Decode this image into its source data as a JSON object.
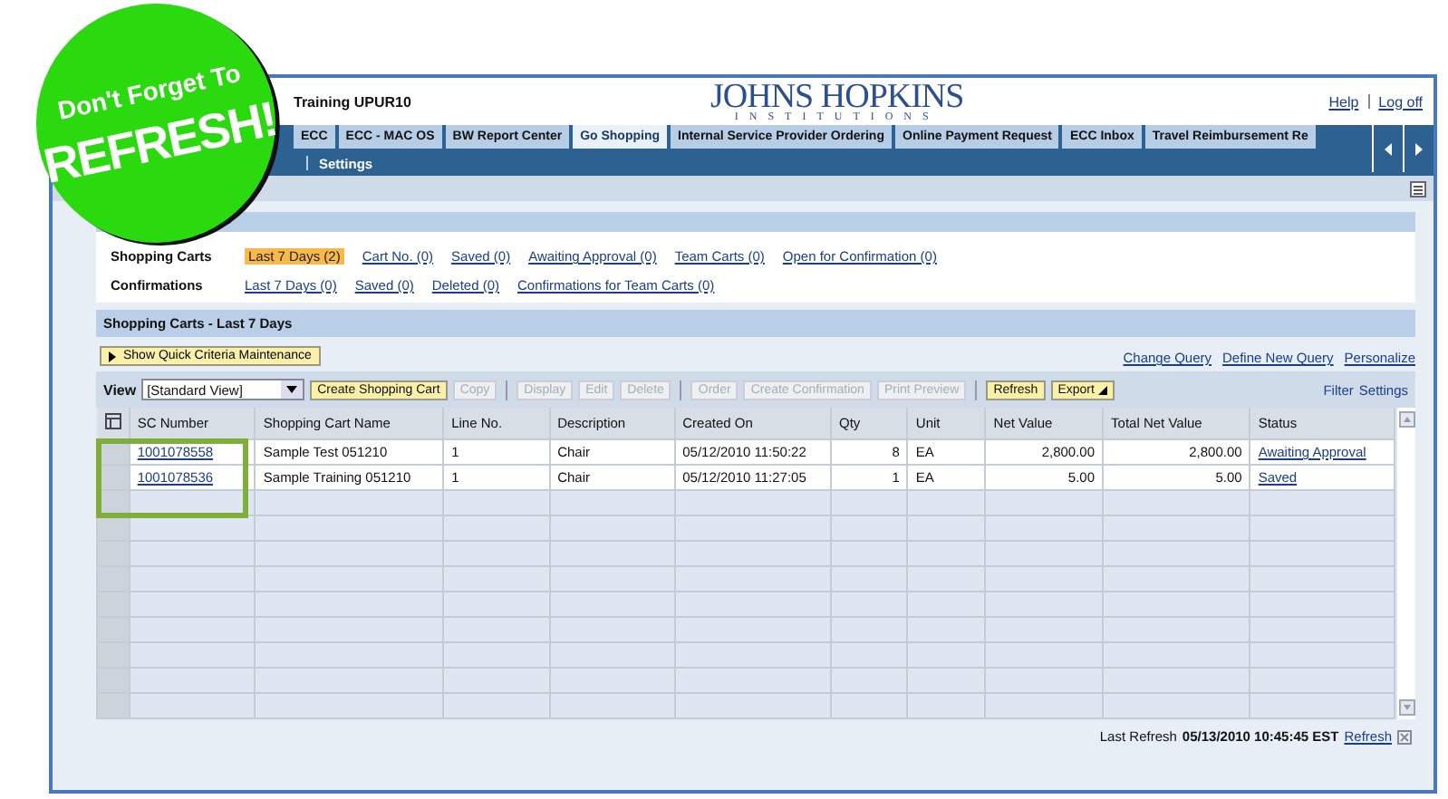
{
  "sticker": {
    "line_1": "Don't Forget To",
    "line_2": "REFRESH!"
  },
  "header": {
    "title": "Training UPUR10",
    "logo": "JOHNS HOPKINS",
    "logo_sub": "INSTITUTIONS",
    "links": [
      "Help",
      "Log off"
    ]
  },
  "tabs": [
    {
      "label": "ECC",
      "selected": false
    },
    {
      "label": "ECC - MAC OS",
      "selected": false
    },
    {
      "label": "BW Report Center",
      "selected": false
    },
    {
      "label": "Go Shopping",
      "selected": true
    },
    {
      "label": "Internal Service Provider Ordering",
      "selected": false
    },
    {
      "label": "Online Payment Request",
      "selected": false
    },
    {
      "label": "ECC Inbox",
      "selected": false
    },
    {
      "label": "Travel Reimbursement Re",
      "selected": false
    }
  ],
  "subnav": [
    "Settings"
  ],
  "queries": [
    {
      "label": "Shopping Carts",
      "links": [
        {
          "label": "Last 7 Days (2)",
          "selected": true
        },
        {
          "label": "Cart No. (0)",
          "selected": false
        },
        {
          "label": "Saved (0)",
          "selected": false
        },
        {
          "label": "Awaiting Approval (0)",
          "selected": false
        },
        {
          "label": "Team Carts (0)",
          "selected": false
        },
        {
          "label": "Open for Confirmation (0)",
          "selected": false
        }
      ]
    },
    {
      "label": "Confirmations",
      "links": [
        {
          "label": "Last 7 Days (0)",
          "selected": false
        },
        {
          "label": "Saved (0)",
          "selected": false
        },
        {
          "label": "Deleted (0)",
          "selected": false
        },
        {
          "label": "Confirmations for Team Carts (0)",
          "selected": false
        }
      ]
    }
  ],
  "panel": {
    "title": "Shopping Carts - Last 7 Days",
    "criteria_button": "Show Quick Criteria Maintenance",
    "query_links": [
      "Change Query",
      "Define New Query",
      "Personalize"
    ],
    "view_label": "View",
    "view_value": "[Standard View]",
    "toolbar": [
      {
        "kind": "button",
        "label": "Create Shopping Cart",
        "disabled": false
      },
      {
        "kind": "button",
        "label": "Copy",
        "disabled": true
      },
      {
        "kind": "separator"
      },
      {
        "kind": "button",
        "label": "Display",
        "disabled": true
      },
      {
        "kind": "button",
        "label": "Edit",
        "disabled": true
      },
      {
        "kind": "button",
        "label": "Delete",
        "disabled": true
      },
      {
        "kind": "separator"
      },
      {
        "kind": "button",
        "label": "Order",
        "disabled": true
      },
      {
        "kind": "button",
        "label": "Create Confirmation",
        "disabled": true
      },
      {
        "kind": "button",
        "label": "Print Preview",
        "disabled": true
      },
      {
        "kind": "separator"
      },
      {
        "kind": "button",
        "label": "Refresh",
        "disabled": false
      },
      {
        "kind": "menu",
        "label": "Export",
        "disabled": false
      }
    ],
    "table_links": [
      "Filter",
      "Settings"
    ]
  },
  "table": {
    "columns": [
      {
        "label": "SC Number",
        "kind": "link"
      },
      {
        "label": "Shopping Cart Name",
        "kind": "text"
      },
      {
        "label": "Line No.",
        "kind": "text"
      },
      {
        "label": "Description",
        "kind": "text"
      },
      {
        "label": "Created On",
        "kind": "text"
      },
      {
        "label": "Qty",
        "kind": "number"
      },
      {
        "label": "Unit",
        "kind": "text"
      },
      {
        "label": "Net Value",
        "kind": "number"
      },
      {
        "label": "Total Net Value",
        "kind": "number"
      },
      {
        "label": "Status",
        "kind": "link"
      }
    ],
    "rows": [
      [
        "1001078558",
        "Sample Test 051210",
        "1",
        "Chair",
        "05/12/2010 11:50:22",
        "8",
        "EA",
        "2,800.00",
        "2,800.00",
        "Awaiting Approval"
      ],
      [
        "1001078536",
        "Sample Training 051210",
        "1",
        "Chair",
        "05/12/2010 11:27:05",
        "1",
        "EA",
        "5.00",
        "5.00",
        "Saved"
      ]
    ]
  },
  "footer": {
    "label": "Last Refresh",
    "timestamp": "05/13/2010 10:45:45 EST",
    "link": "Refresh"
  }
}
